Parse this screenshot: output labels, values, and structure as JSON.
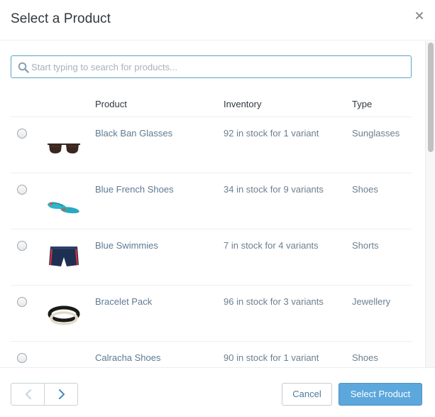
{
  "modal": {
    "title": "Select a Product",
    "close_icon": "close-icon"
  },
  "search": {
    "placeholder": "Start typing to search for products...",
    "value": "",
    "icon": "search-icon"
  },
  "table": {
    "columns": [
      "Product",
      "Inventory",
      "Type"
    ],
    "rows": [
      {
        "name": "Black Ban Glasses",
        "inventory": "92 in stock for 1 variant",
        "type": "Sunglasses",
        "thumbnail": "sunglasses-thumbnail",
        "selected": false
      },
      {
        "name": "Blue French Shoes",
        "inventory": "34 in stock for 9 variants",
        "type": "Shoes",
        "thumbnail": "shoes-thumbnail",
        "selected": false
      },
      {
        "name": "Blue Swimmies",
        "inventory": "7 in stock for 4 variants",
        "type": "Shorts",
        "thumbnail": "swim-shorts-thumbnail",
        "selected": false
      },
      {
        "name": "Bracelet Pack",
        "inventory": "96 in stock for 3 variants",
        "type": "Jewellery",
        "thumbnail": "bracelet-thumbnail",
        "selected": false
      },
      {
        "name": "Calracha Shoes",
        "inventory": "90 in stock for 1 variant",
        "type": "Shoes",
        "thumbnail": "heels-thumbnail",
        "selected": false
      }
    ]
  },
  "footer": {
    "prev_icon": "chevron-left-icon",
    "next_icon": "chevron-right-icon",
    "cancel_label": "Cancel",
    "select_label": "Select Product"
  },
  "colors": {
    "accent": "#5ca7dc",
    "link": "#5e7a93",
    "border": "#ebeef0"
  }
}
